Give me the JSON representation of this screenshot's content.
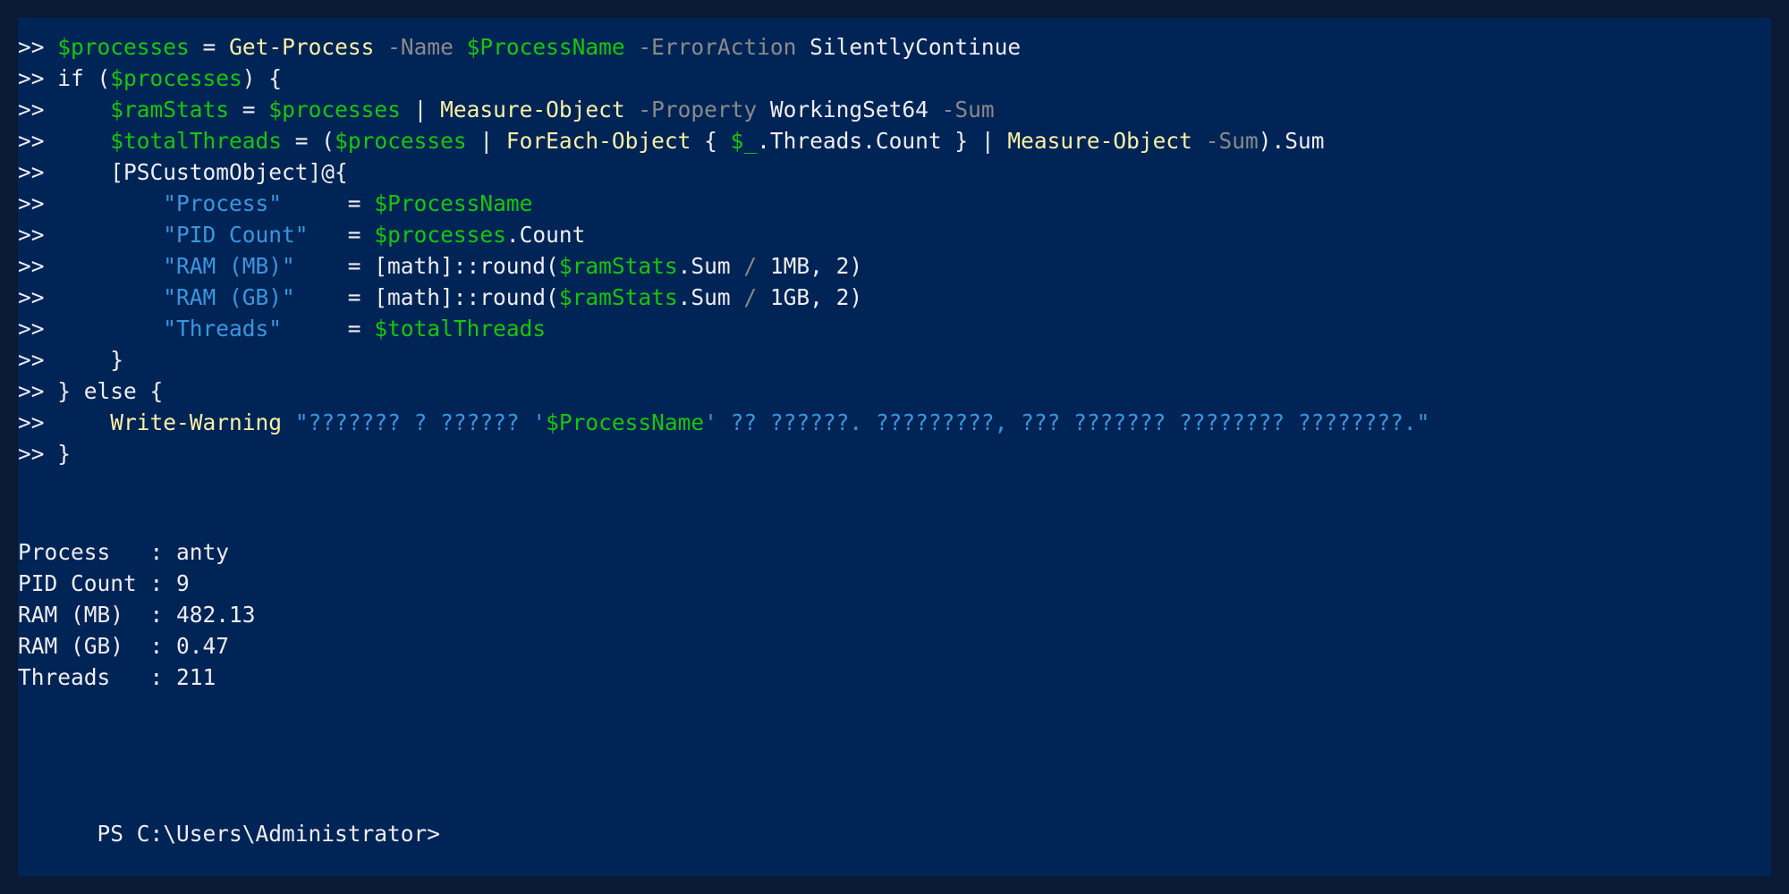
{
  "terminal": {
    "colors": {
      "background": "#012456",
      "foreground": "#eeedf0",
      "variable": "#16c60c",
      "command": "#f9f1a5",
      "parameter": "#8a8a8a",
      "string": "#3a96dd"
    },
    "prompt_continuation": ">>",
    "code_lines": [
      [
        {
          "t": "txt",
          "v": " "
        },
        {
          "t": "var",
          "v": "$processes"
        },
        {
          "t": "txt",
          "v": " = "
        },
        {
          "t": "cmd",
          "v": "Get-Process"
        },
        {
          "t": "txt",
          "v": " "
        },
        {
          "t": "param",
          "v": "-Name"
        },
        {
          "t": "txt",
          "v": " "
        },
        {
          "t": "var",
          "v": "$ProcessName"
        },
        {
          "t": "txt",
          "v": " "
        },
        {
          "t": "param",
          "v": "-ErrorAction"
        },
        {
          "t": "txt",
          "v": " SilentlyContinue"
        }
      ],
      [
        {
          "t": "txt",
          "v": " if ("
        },
        {
          "t": "var",
          "v": "$processes"
        },
        {
          "t": "txt",
          "v": ") {"
        }
      ],
      [
        {
          "t": "txt",
          "v": "     "
        },
        {
          "t": "var",
          "v": "$ramStats"
        },
        {
          "t": "txt",
          "v": " = "
        },
        {
          "t": "var",
          "v": "$processes"
        },
        {
          "t": "txt",
          "v": " | "
        },
        {
          "t": "cmd",
          "v": "Measure-Object"
        },
        {
          "t": "txt",
          "v": " "
        },
        {
          "t": "param",
          "v": "-Property"
        },
        {
          "t": "txt",
          "v": " WorkingSet64 "
        },
        {
          "t": "param",
          "v": "-Sum"
        }
      ],
      [
        {
          "t": "txt",
          "v": "     "
        },
        {
          "t": "var",
          "v": "$totalThreads"
        },
        {
          "t": "txt",
          "v": " = ("
        },
        {
          "t": "var",
          "v": "$processes"
        },
        {
          "t": "txt",
          "v": " | "
        },
        {
          "t": "cmd",
          "v": "ForEach-Object"
        },
        {
          "t": "txt",
          "v": " { "
        },
        {
          "t": "var",
          "v": "$_"
        },
        {
          "t": "txt",
          "v": ".Threads.Count } | "
        },
        {
          "t": "cmd",
          "v": "Measure-Object"
        },
        {
          "t": "txt",
          "v": " "
        },
        {
          "t": "param",
          "v": "-Sum"
        },
        {
          "t": "txt",
          "v": ").Sum"
        }
      ],
      [
        {
          "t": "txt",
          "v": "     [PSCustomObject]@{"
        }
      ],
      [
        {
          "t": "txt",
          "v": "         "
        },
        {
          "t": "str",
          "v": "\"Process\""
        },
        {
          "t": "txt",
          "v": "     = "
        },
        {
          "t": "var",
          "v": "$ProcessName"
        }
      ],
      [
        {
          "t": "txt",
          "v": "         "
        },
        {
          "t": "str",
          "v": "\"PID Count\""
        },
        {
          "t": "txt",
          "v": "   = "
        },
        {
          "t": "var",
          "v": "$processes"
        },
        {
          "t": "txt",
          "v": ".Count"
        }
      ],
      [
        {
          "t": "txt",
          "v": "         "
        },
        {
          "t": "str",
          "v": "\"RAM (MB)\""
        },
        {
          "t": "txt",
          "v": "    = [math]::round("
        },
        {
          "t": "var",
          "v": "$ramStats"
        },
        {
          "t": "txt",
          "v": ".Sum "
        },
        {
          "t": "op",
          "v": "/"
        },
        {
          "t": "txt",
          "v": " 1MB, 2)"
        }
      ],
      [
        {
          "t": "txt",
          "v": "         "
        },
        {
          "t": "str",
          "v": "\"RAM (GB)\""
        },
        {
          "t": "txt",
          "v": "    = [math]::round("
        },
        {
          "t": "var",
          "v": "$ramStats"
        },
        {
          "t": "txt",
          "v": ".Sum "
        },
        {
          "t": "op",
          "v": "/"
        },
        {
          "t": "txt",
          "v": " 1GB, 2)"
        }
      ],
      [
        {
          "t": "txt",
          "v": "         "
        },
        {
          "t": "str",
          "v": "\"Threads\""
        },
        {
          "t": "txt",
          "v": "     = "
        },
        {
          "t": "var",
          "v": "$totalThreads"
        }
      ],
      [
        {
          "t": "txt",
          "v": "     }"
        }
      ],
      [
        {
          "t": "txt",
          "v": " } else {"
        }
      ],
      [
        {
          "t": "txt",
          "v": "     "
        },
        {
          "t": "cmd",
          "v": "Write-Warning"
        },
        {
          "t": "txt",
          "v": " "
        },
        {
          "t": "str",
          "v": "\"??????? ? ?????? '"
        },
        {
          "t": "var",
          "v": "$ProcessName"
        },
        {
          "t": "str",
          "v": "' ?? ??????. ?????????, ??? ??????? ???????? ????????.\""
        }
      ],
      [
        {
          "t": "txt",
          "v": " }"
        }
      ]
    ],
    "output": [
      {
        "key": "Process  ",
        "sep": " : ",
        "value": "anty"
      },
      {
        "key": "PID Count",
        "sep": " : ",
        "value": "9"
      },
      {
        "key": "RAM (MB) ",
        "sep": " : ",
        "value": "482.13"
      },
      {
        "key": "RAM (GB) ",
        "sep": " : ",
        "value": "0.47"
      },
      {
        "key": "Threads  ",
        "sep": " : ",
        "value": "211"
      }
    ],
    "prompt": "PS C:\\Users\\Administrator>"
  }
}
